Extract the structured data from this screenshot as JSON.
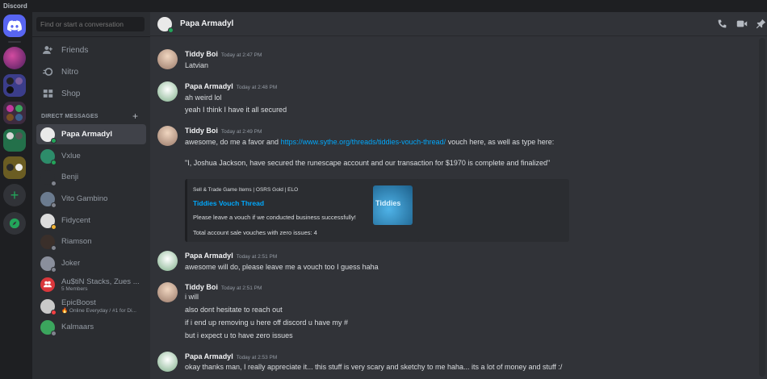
{
  "app": {
    "title": "Discord"
  },
  "search": {
    "placeholder": "Find or start a conversation"
  },
  "nav": [
    {
      "label": "Friends",
      "icon": "friends-icon"
    },
    {
      "label": "Nitro",
      "icon": "nitro-icon"
    },
    {
      "label": "Shop",
      "icon": "shop-icon"
    }
  ],
  "dm_section": {
    "title": "DIRECT MESSAGES"
  },
  "dms": [
    {
      "name": "Papa Armadyl",
      "subtitle": "",
      "status": "online",
      "selected": true
    },
    {
      "name": "Vxlue",
      "subtitle": "",
      "status": "online"
    },
    {
      "name": "Benji",
      "subtitle": "",
      "status": "offline"
    },
    {
      "name": "Vito Gambino",
      "subtitle": "",
      "status": "offline"
    },
    {
      "name": "Fidycent",
      "subtitle": "",
      "status": "idle"
    },
    {
      "name": "Riamson",
      "subtitle": "",
      "status": "offline"
    },
    {
      "name": "Joker",
      "subtitle": "",
      "status": "offline"
    },
    {
      "name": "Au$tiN Stacks, Zues ...",
      "subtitle": "5 Members",
      "status": ""
    },
    {
      "name": "EpicBoost",
      "subtitle": "🔥 Online Everyday / #1 for Di...",
      "status": "dnd"
    },
    {
      "name": "Kalmaars",
      "subtitle": "",
      "status": "offline"
    }
  ],
  "header": {
    "name": "Papa Armadyl"
  },
  "messages": [
    {
      "author": "Tiddy Boi",
      "time": "Today at 2:47 PM",
      "lines": [
        "Latvian"
      ]
    },
    {
      "author": "Papa Armadyl",
      "time": "Today at 2:48 PM",
      "lines": [
        "ah weird lol",
        "yeah I think I have it all secured"
      ]
    },
    {
      "author": "Tiddy Boi",
      "time": "Today at 2:49 PM",
      "line1_pre": "awesome, do me a favor and ",
      "line1_link": "https://www.sythe.org/threads/tiddies-vouch-thread/",
      "line1_post": " vouch here, as well as type here:",
      "quote": "\"I, Joshua Jackson, have secured the runescape account and our transaction for $1970 is complete and finalized\""
    },
    {
      "author": "Papa Armadyl",
      "time": "Today at 2:51 PM",
      "lines": [
        "awesome will do, please leave me a vouch too I guess haha"
      ]
    },
    {
      "author": "Tiddy Boi",
      "time": "Today at 2:51 PM",
      "lines": [
        "i will",
        "also dont hesitate to reach out",
        "if i end up removing u here off discord u have my #",
        "but i expect u to have zero issues"
      ]
    },
    {
      "author": "Papa Armadyl",
      "time": "Today at 2:53 PM",
      "lines": [
        "okay thanks man, I really appreciate it... this stuff is very scary and sketchy to me haha... its a lot of money and stuff :/"
      ]
    }
  ],
  "embed": {
    "provider": "Sell & Trade Game Items | OSRS Gold | ELO",
    "title": "Tiddies Vouch Thread",
    "description": "Please leave a vouch if we conducted business successfully!",
    "footer": "Total account sale vouches with zero issues: 4",
    "thumb_text": "Tiddies"
  },
  "colors": {
    "blurple": "#5865f2",
    "link": "#00a8fc",
    "online": "#23a55a"
  }
}
